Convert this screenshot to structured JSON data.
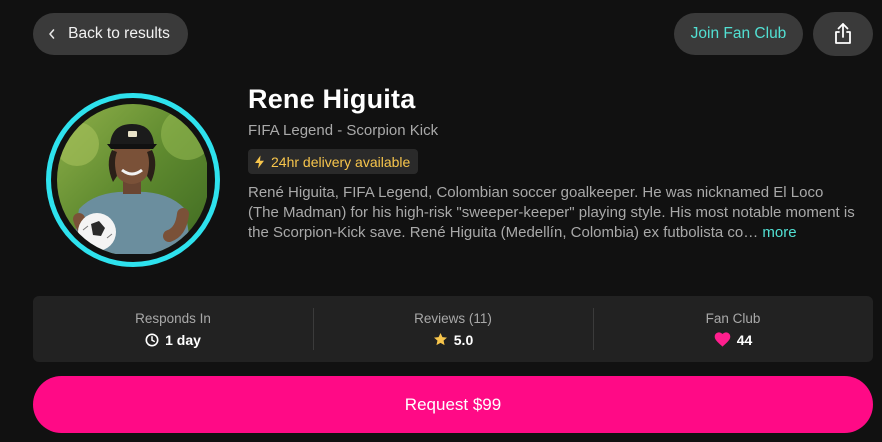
{
  "nav": {
    "back_label": "Back to results",
    "join_label": "Join Fan Club",
    "share_icon": "share-icon"
  },
  "profile": {
    "name": "Rene Higuita",
    "subtitle": "FIFA Legend - Scorpion Kick",
    "badge": "24hr delivery available",
    "description": "René Higuita, FIFA Legend, Colombian soccer goalkeeper. He was nicknamed El Loco (The Madman) for his high-risk \"sweeper-keeper\" playing style. His most notable moment is the Scorpion-Kick save. René Higuita (Medellín, Colombia) ex futbolista co…",
    "more_label": "more",
    "ring_color": "#2ee2ee"
  },
  "stats": [
    {
      "label": "Responds In",
      "value": "1 day",
      "icon": "clock-icon"
    },
    {
      "label": "Reviews (11)",
      "value": "5.0",
      "icon": "star-icon"
    },
    {
      "label": "Fan Club",
      "value": "44",
      "icon": "heart-icon"
    }
  ],
  "cta": {
    "label": "Request $99",
    "color": "#ff0a86"
  },
  "colors": {
    "background": "#111111",
    "accent_teal": "#52e0d3",
    "badge_yellow": "#f7c54c"
  }
}
